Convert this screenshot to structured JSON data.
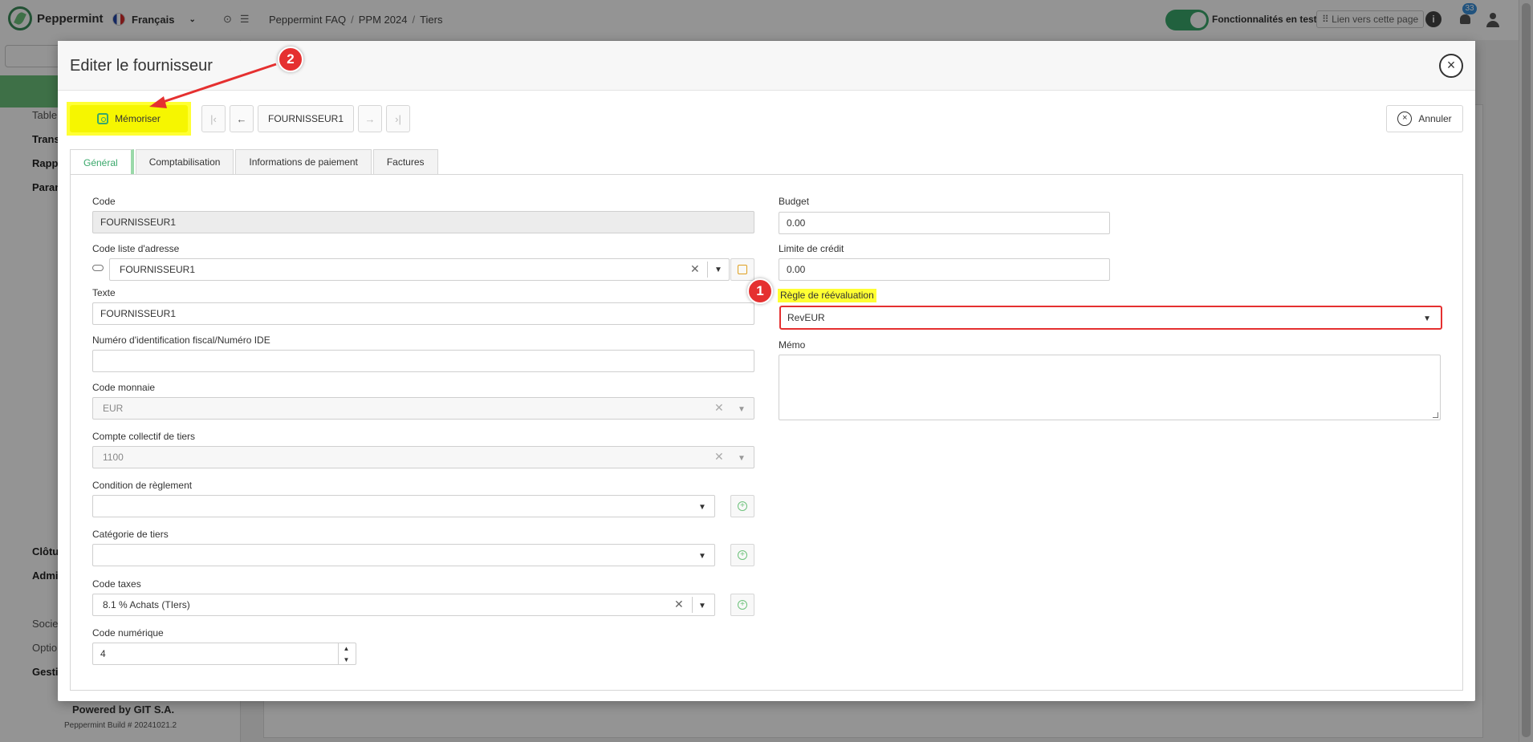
{
  "app": {
    "brand": "Peppermint",
    "language": "Français",
    "breadcrumb": [
      "Peppermint FAQ",
      "PPM 2024",
      "Tiers"
    ],
    "test_features": "Fonctionnalités en test",
    "page_link": "⠿ Lien vers cette page",
    "notification_count": "33",
    "footer_powered": "Powered by GIT S.A.",
    "footer_build": "Peppermint Build # 20241021.2"
  },
  "modal": {
    "title": "Editer le fournisseur",
    "save_label": "Mémoriser",
    "record_label": "FOURNISSEUR1",
    "cancel_label": "Annuler",
    "tabs": [
      "Général",
      "Comptabilisation",
      "Informations de paiement",
      "Factures"
    ],
    "active_tab": "Général"
  },
  "form": {
    "code": {
      "label": "Code",
      "value": "FOURNISSEUR1"
    },
    "address_list": {
      "label": "Code liste d'adresse",
      "value": "FOURNISSEUR1"
    },
    "text": {
      "label": "Texte",
      "value": "FOURNISSEUR1"
    },
    "tax_id": {
      "label": "Numéro d'identification fiscal/Numéro IDE",
      "value": ""
    },
    "currency": {
      "label": "Code monnaie",
      "value": "EUR"
    },
    "collective_account": {
      "label": "Compte collectif de tiers",
      "value": "1100"
    },
    "payment_condition": {
      "label": "Condition de règlement",
      "value": ""
    },
    "third_party_category": {
      "label": "Catégorie de tiers",
      "value": ""
    },
    "tax_code": {
      "label": "Code taxes",
      "value": "8.1 % Achats (TIers)"
    },
    "numeric_code": {
      "label": "Code numérique",
      "value": "4"
    },
    "budget": {
      "label": "Budget",
      "value": "0.00"
    },
    "credit_limit": {
      "label": "Limite de crédit",
      "value": "0.00"
    },
    "revaluation_rule": {
      "label": "Règle de réévaluation",
      "value": "RevEUR"
    },
    "memo": {
      "label": "Mémo",
      "value": ""
    }
  },
  "annotations": {
    "marker_1": "1",
    "marker_2": "2"
  },
  "colors": {
    "accent": "#3aa86b",
    "highlight": "#ffff33",
    "annotation": "#e53030"
  }
}
